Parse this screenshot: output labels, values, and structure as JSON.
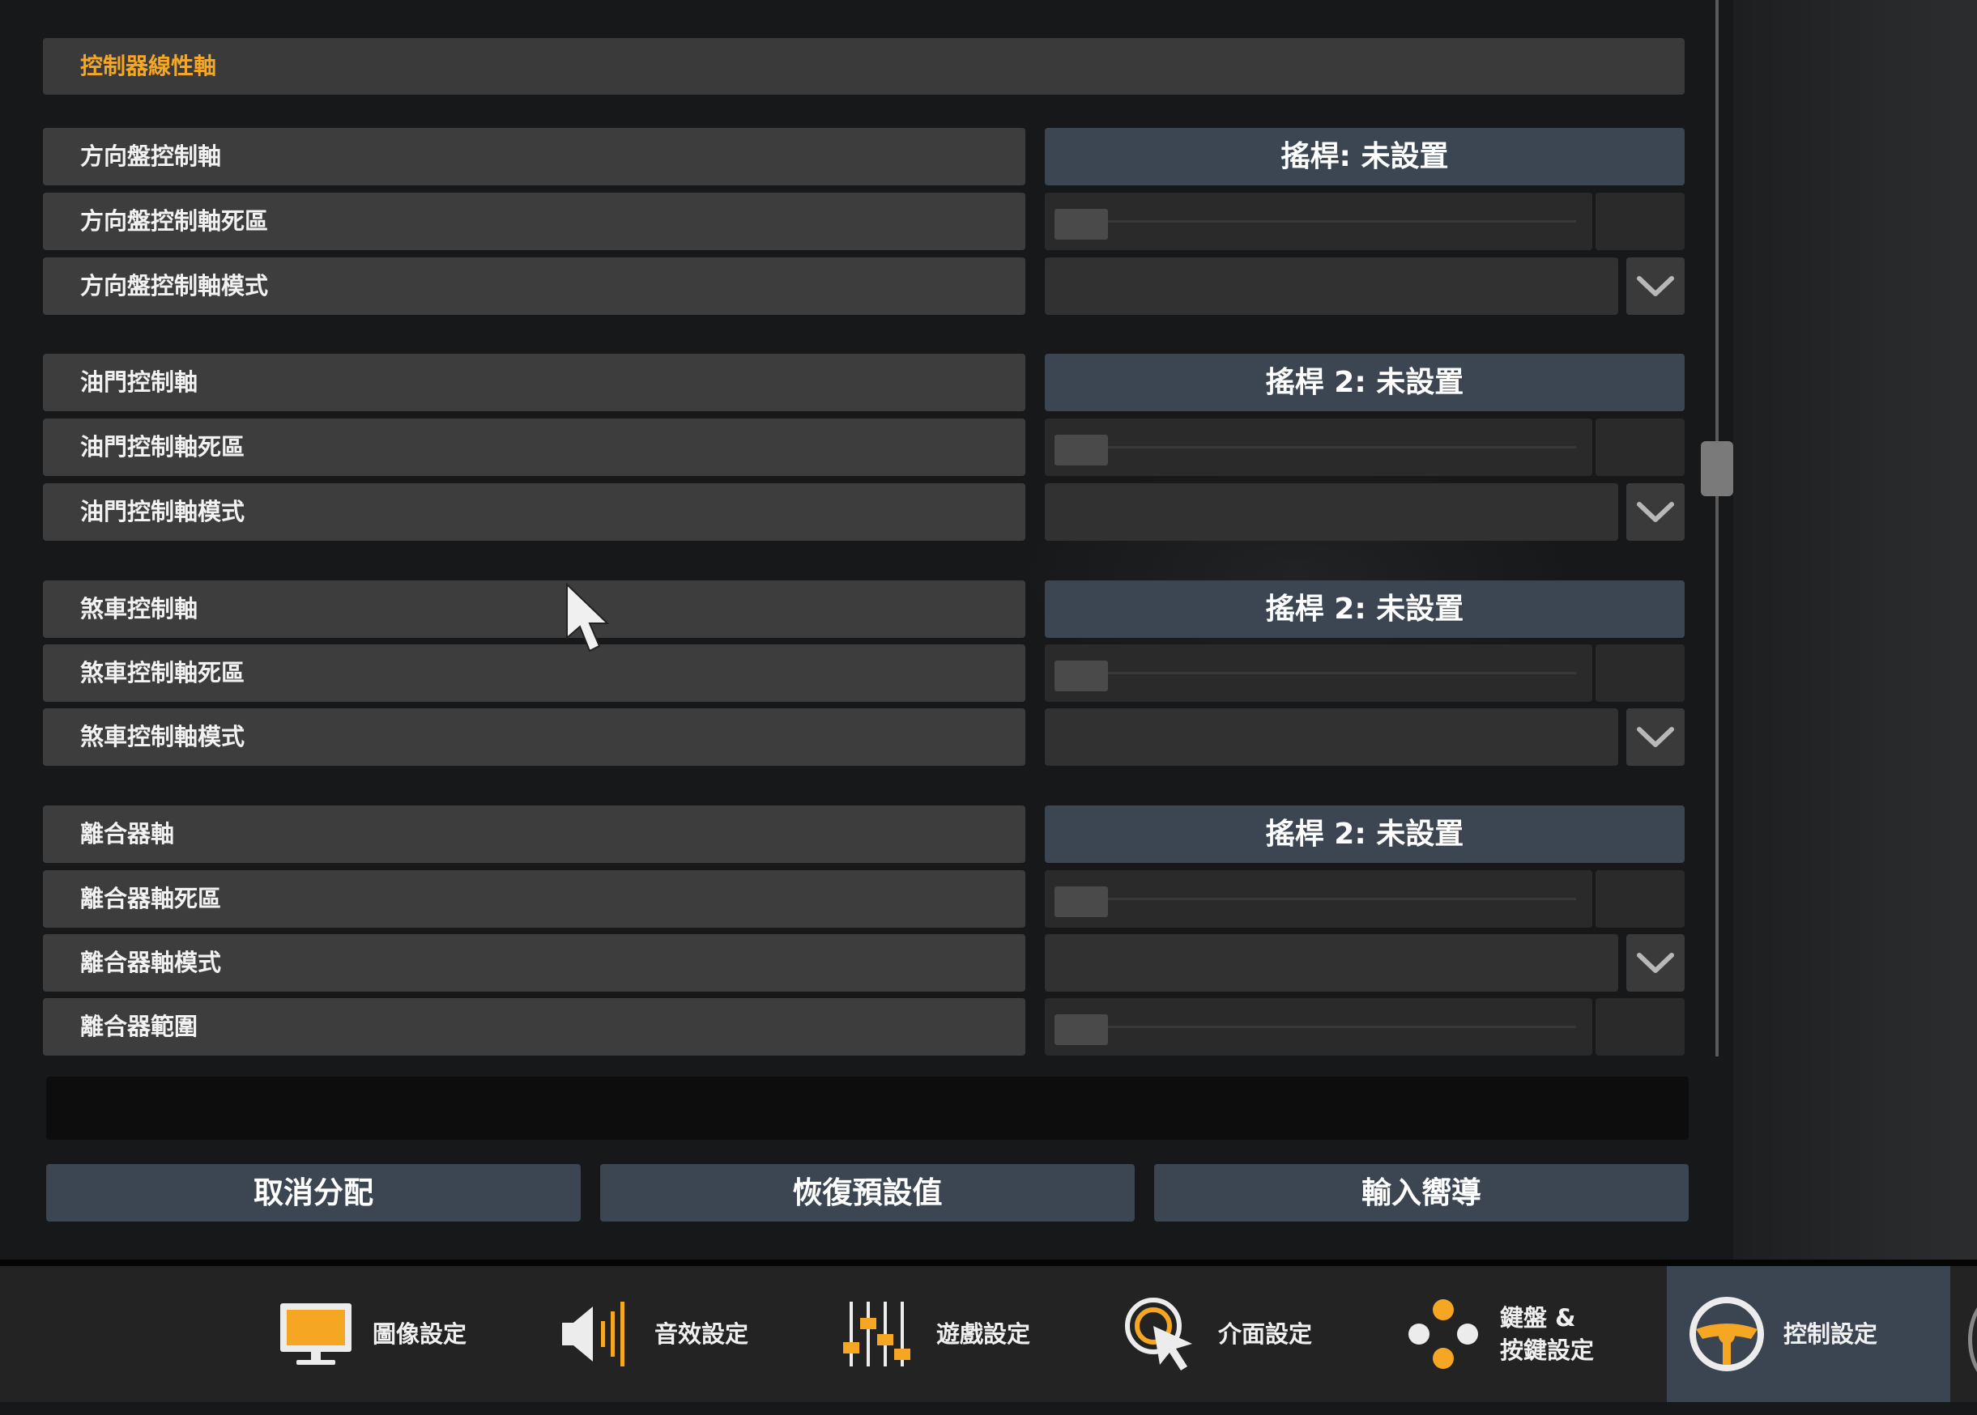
{
  "section_title": "控制器線性軸",
  "groups": [
    {
      "axis": "方向盤控制軸",
      "deadzone": "方向盤控制軸死區",
      "mode": "方向盤控制軸模式",
      "assignment": "搖桿: 未設置"
    },
    {
      "axis": "油門控制軸",
      "deadzone": "油門控制軸死區",
      "mode": "油門控制軸模式",
      "assignment": "搖桿 2: 未設置"
    },
    {
      "axis": "煞車控制軸",
      "deadzone": "煞車控制軸死區",
      "mode": "煞車控制軸模式",
      "assignment": "搖桿 2: 未設置"
    },
    {
      "axis": "離合器軸",
      "deadzone": "離合器軸死區",
      "mode": "離合器軸模式",
      "assignment": "搖桿 2: 未設置",
      "range": "離合器範圍"
    }
  ],
  "buttons": {
    "unassign": "取消分配",
    "restore_defaults": "恢復預設值",
    "input_wizard": "輸入嚮導"
  },
  "nav": {
    "graphics": "圖像設定",
    "audio": "音效設定",
    "gameplay": "遊戲設定",
    "interface": "介面設定",
    "keyboard_line1": "鍵盤 &",
    "keyboard_line2": "按鍵設定",
    "controls": "控制設定"
  },
  "colors": {
    "accent": "#f5a623",
    "button": "#3b4652",
    "row": "#3d3d3d",
    "active_nav": "#3a4551"
  },
  "icons": [
    "monitor-icon",
    "speaker-icon",
    "sliders-icon",
    "pointer-icon",
    "gamepad-icon",
    "steering-wheel-icon",
    "chevron-down-icon",
    "mouse-cursor-icon"
  ]
}
